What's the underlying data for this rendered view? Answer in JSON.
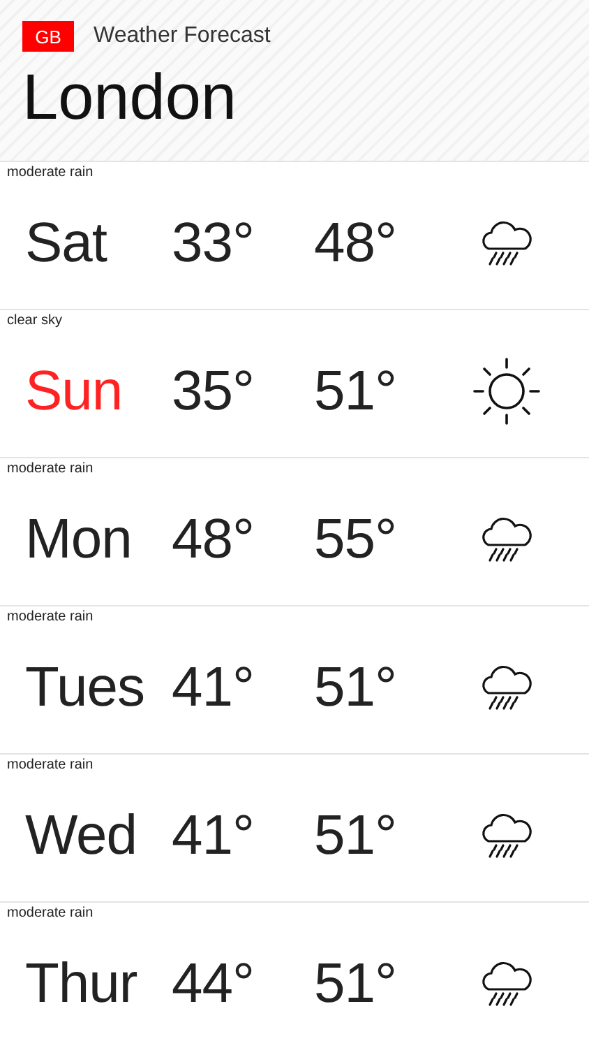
{
  "header": {
    "country": "GB",
    "title": "Weather Forecast",
    "city": "London"
  },
  "days": [
    {
      "condition": "moderate rain",
      "day": "Sat",
      "low": "33°",
      "high": "48°",
      "kind": "rain",
      "today": false
    },
    {
      "condition": "clear sky",
      "day": "Sun",
      "low": "35°",
      "high": "51°",
      "kind": "clear",
      "today": true
    },
    {
      "condition": "moderate rain",
      "day": "Mon",
      "low": "48°",
      "high": "55°",
      "kind": "rain",
      "today": false
    },
    {
      "condition": "moderate rain",
      "day": "Tues",
      "low": "41°",
      "high": "51°",
      "kind": "rain",
      "today": false
    },
    {
      "condition": "moderate rain",
      "day": "Wed",
      "low": "41°",
      "high": "51°",
      "kind": "rain",
      "today": false
    },
    {
      "condition": "moderate rain",
      "day": "Thur",
      "low": "44°",
      "high": "51°",
      "kind": "rain",
      "today": false
    }
  ]
}
